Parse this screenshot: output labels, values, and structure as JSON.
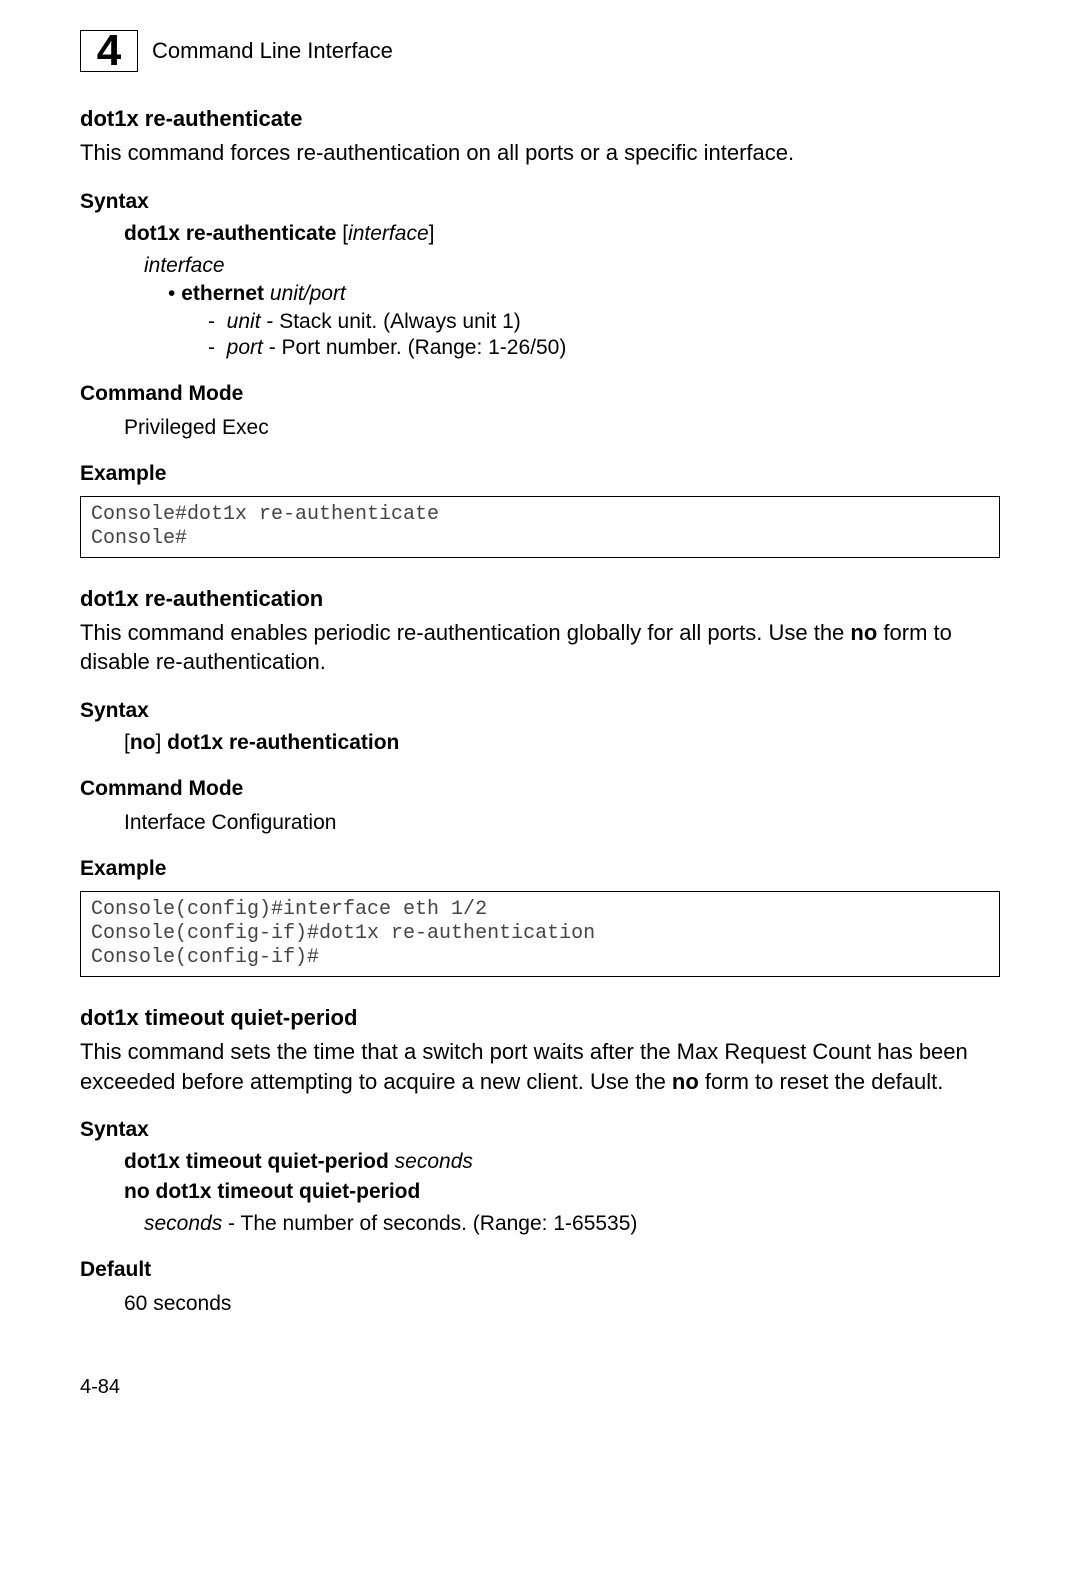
{
  "header": {
    "chapter_number": "4",
    "title": "Command Line Interface"
  },
  "sec1": {
    "title": "dot1x re-authenticate",
    "desc": "This command forces re-authentication on all ports or a specific interface.",
    "syntax_label": "Syntax",
    "syntax_cmd": "dot1x re-authenticate",
    "syntax_arg": "interface",
    "param_interface": "interface",
    "eth_label": "ethernet",
    "eth_arg": "unit/port",
    "unit_term": "unit",
    "unit_desc": " - Stack unit. (Always unit 1)",
    "port_term": "port",
    "port_desc": " - Port number. (Range: 1-26/50)",
    "mode_label": "Command Mode",
    "mode_value": "Privileged Exec",
    "example_label": "Example",
    "example_code": "Console#dot1x re-authenticate\nConsole#"
  },
  "sec2": {
    "title": "dot1x re-authentication",
    "desc_a": "This command enables periodic re-authentication globally for all ports. Use the ",
    "desc_bold": "no",
    "desc_b": " form to disable re-authentication.",
    "syntax_label": "Syntax",
    "syntax_no": "no",
    "syntax_cmd": "dot1x re-authentication",
    "mode_label": "Command Mode",
    "mode_value": "Interface Configuration",
    "example_label": "Example",
    "example_code": "Console(config)#interface eth 1/2\nConsole(config-if)#dot1x re-authentication\nConsole(config-if)#"
  },
  "sec3": {
    "title": "dot1x timeout quiet-period",
    "desc_a": "This command sets the time that a switch port waits after the Max Request Count has been exceeded before attempting to acquire a new client. Use the ",
    "desc_bold": "no",
    "desc_b": " form to reset the default.",
    "syntax_label": "Syntax",
    "syntax_cmd1": "dot1x timeout quiet-period",
    "syntax_arg1": "seconds",
    "syntax_cmd2": "no dot1x timeout quiet-period",
    "seconds_term": "seconds",
    "seconds_desc": " - The number of seconds. (Range: 1-65535)",
    "default_label": "Default",
    "default_value": "60 seconds"
  },
  "page_number": "4-84"
}
